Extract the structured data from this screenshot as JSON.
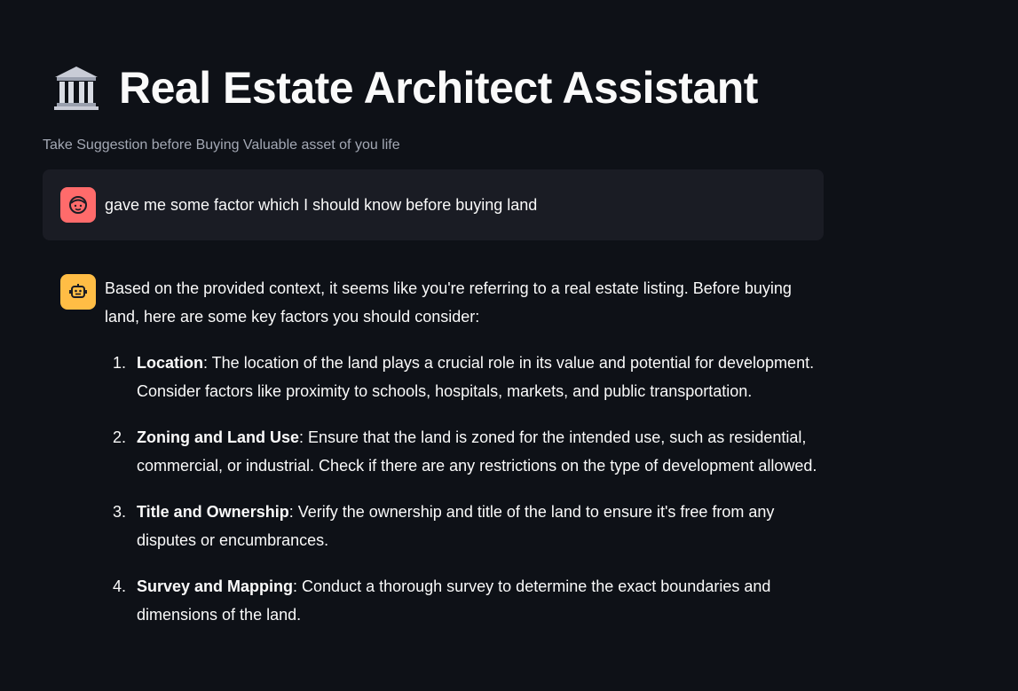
{
  "header": {
    "title": "Real Estate Architect Assistant",
    "title_icon": "classical-building-icon",
    "caption": "Take Suggestion before Buying Valuable asset of you life"
  },
  "chat": {
    "user_message": {
      "avatar_icon": "user-face-icon",
      "text": "gave me some factor which I should know before buying land"
    },
    "assistant_message": {
      "avatar_icon": "robot-icon",
      "intro": "Based on the provided context, it seems like you're referring to a real estate listing. Before buying land, here are some key factors you should consider:",
      "factors": [
        {
          "number": "1.",
          "title": "Location",
          "text": ": The location of the land plays a crucial role in its value and potential for development. Consider factors like proximity to schools, hospitals, markets, and public transportation."
        },
        {
          "number": "2.",
          "title": "Zoning and Land Use",
          "text": ": Ensure that the land is zoned for the intended use, such as residential, commercial, or industrial. Check if there are any restrictions on the type of development allowed."
        },
        {
          "number": "3.",
          "title": "Title and Ownership",
          "text": ": Verify the ownership and title of the land to ensure it's free from any disputes or encumbrances."
        },
        {
          "number": "4.",
          "title": "Survey and Mapping",
          "text": ": Conduct a thorough survey to determine the exact boundaries and dimensions of the land."
        }
      ]
    }
  },
  "colors": {
    "background": "#0e1117",
    "user_bubble": "#1a1c24",
    "user_avatar": "#ff6b6b",
    "assistant_avatar": "#ffbd45",
    "text": "#fafafa",
    "caption": "#a3a8b4"
  }
}
